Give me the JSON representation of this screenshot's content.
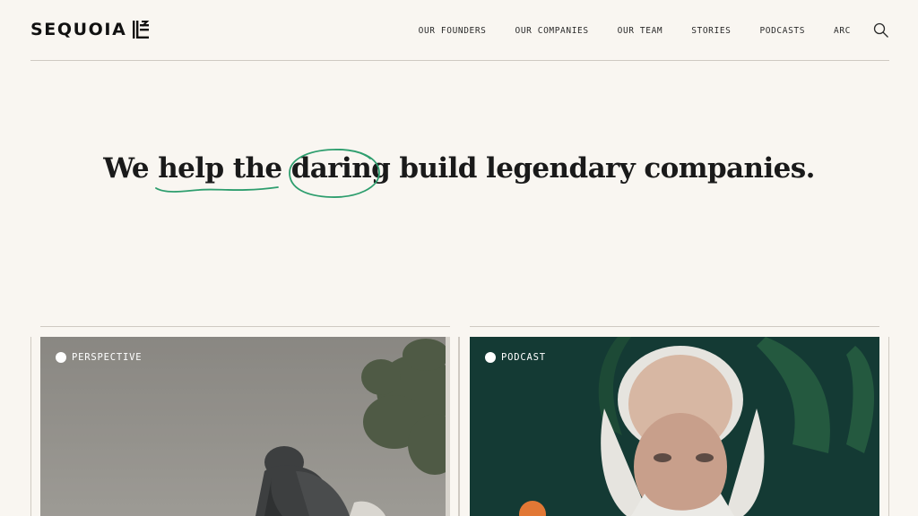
{
  "brand": {
    "name": "SEQUOIA"
  },
  "nav": {
    "items": [
      "OUR FOUNDERS",
      "OUR COMPANIES",
      "OUR TEAM",
      "STORIES",
      "PODCASTS",
      "ARC"
    ],
    "search_icon": "search-icon"
  },
  "hero": {
    "part1": "We",
    "part2": "help the",
    "part3": "daring",
    "part4": "build legendary companies.",
    "accent_color": "#2e9e6e"
  },
  "cards": [
    {
      "tag": "PERSPECTIVE",
      "image": "statue-photo"
    },
    {
      "tag": "PODCAST",
      "image": "portrait-photo"
    }
  ],
  "colors": {
    "background": "#f9f6f1",
    "text": "#1a1a1a",
    "accent": "#2e9e6e"
  }
}
